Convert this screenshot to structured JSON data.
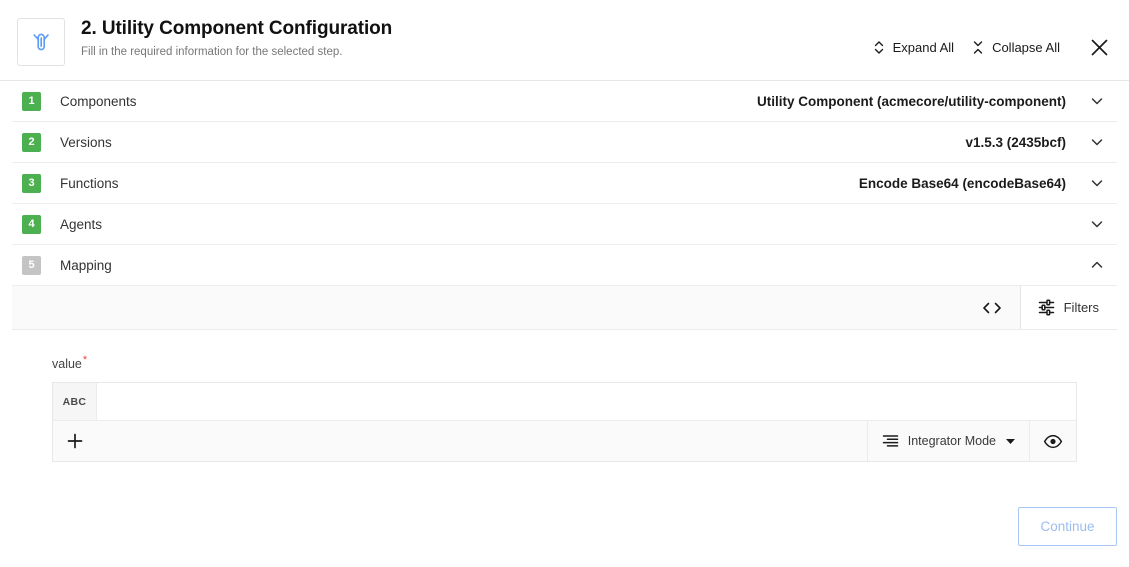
{
  "header": {
    "icon": "utility-knife-icon",
    "title": "2. Utility Component Configuration",
    "subtitle": "Fill in the required information for the selected step.",
    "expand_all_label": "Expand All",
    "collapse_all_label": "Collapse All",
    "close_label": "Close"
  },
  "accordion": {
    "steps": [
      {
        "number": "1",
        "label": "Components",
        "value": "Utility Component (acmecore/utility-component)",
        "state": "complete",
        "expanded": false
      },
      {
        "number": "2",
        "label": "Versions",
        "value": "v1.5.3 (2435bcf)",
        "state": "complete",
        "expanded": false
      },
      {
        "number": "3",
        "label": "Functions",
        "value": "Encode Base64 (encodeBase64)",
        "state": "complete",
        "expanded": false
      },
      {
        "number": "4",
        "label": "Agents",
        "value": "",
        "state": "complete",
        "expanded": false
      },
      {
        "number": "5",
        "label": "Mapping",
        "value": "",
        "state": "pending",
        "expanded": true
      }
    ]
  },
  "mapping": {
    "toolbar": {
      "code_icon": "code-brackets-icon",
      "filters_icon": "tune-sliders-icon",
      "filters_label": "Filters"
    },
    "field": {
      "label": "value",
      "required_marker": "*",
      "type_badge": "ABC",
      "input_value": "",
      "input_placeholder": ""
    },
    "footer_row": {
      "add_icon": "plus-icon",
      "mode_icon": "list-lines-icon",
      "mode_label": "Integrator Mode",
      "mode_chevron": "chevron-down-icon",
      "preview_icon": "eye-icon"
    }
  },
  "footer": {
    "continue_label": "Continue"
  },
  "colors": {
    "badge_complete": "#4caf50",
    "badge_pending": "#c4c4c4",
    "required_star": "#f44336",
    "accent_icon": "#5b9bf8",
    "continue_disabled_text": "#9bbdf0",
    "continue_disabled_border": "#a8c7f5"
  }
}
